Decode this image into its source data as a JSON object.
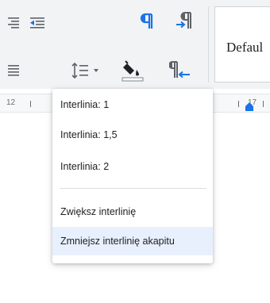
{
  "style_box": {
    "value": "Defaul"
  },
  "ruler": {
    "left_number": "12",
    "right_number": "17"
  },
  "menu": {
    "items": [
      {
        "label": "Interlinia: 1"
      },
      {
        "label": "Interlinia: 1,5"
      },
      {
        "label": "Interlinia: 2"
      },
      {
        "label": "Zwiększ interlinię"
      },
      {
        "label": "Zmniejsz interlinię akapitu"
      }
    ],
    "highlighted_index": 4
  },
  "colors": {
    "toolbar_bg": "#f1f3f4",
    "icon_gray": "#5f6368",
    "accent_blue": "#1a73e8",
    "hover_bg": "#e8f0fe"
  },
  "icons": [
    "align-right-icon",
    "decrease-indent-icon",
    "pilcrow-icon",
    "paragraph-ltr-icon",
    "align-justify-icon",
    "line-spacing-icon",
    "chevron-down-icon",
    "fill-color-icon",
    "paragraph-rtl-icon",
    "indent-marker-icon"
  ]
}
